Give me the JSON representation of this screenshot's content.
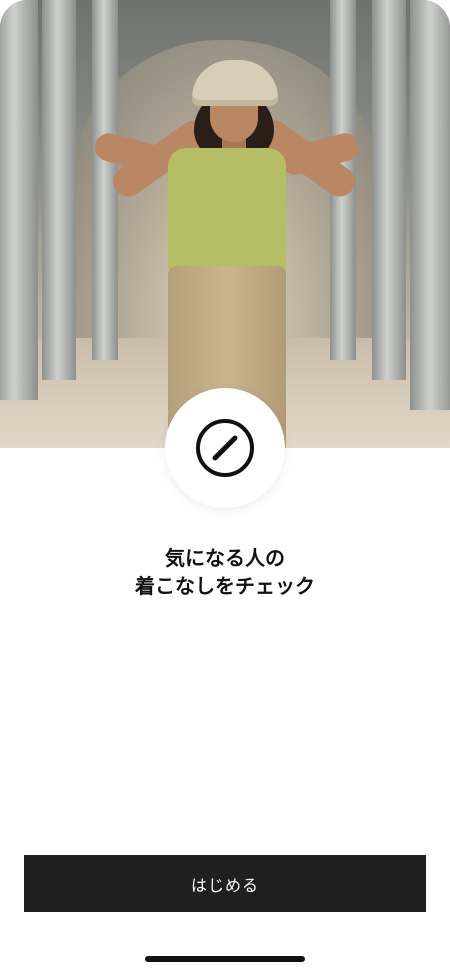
{
  "hero": {
    "icon": "pencil-icon"
  },
  "headline": {
    "line1": "気になる人の",
    "line2": "着こなしをチェック"
  },
  "cta": {
    "label": "はじめる"
  },
  "colors": {
    "button_bg": "#1f1f1f",
    "button_text": "#ffffff",
    "text": "#111111",
    "background": "#ffffff"
  }
}
